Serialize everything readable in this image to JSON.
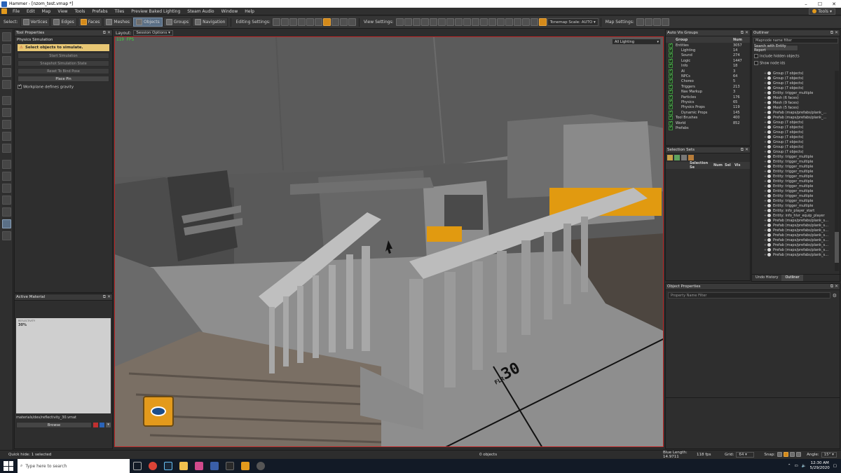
{
  "window": {
    "title": "Hammer - [nzom_test.vmap *]"
  },
  "menu": [
    "File",
    "Edit",
    "Map",
    "View",
    "Tools",
    "Prefabs",
    "Tiles",
    "Preview Baked Lighting",
    "Steam Audio",
    "Window",
    "Help"
  ],
  "menu_tools_right": "Tools",
  "toolbar": {
    "select_label": "Select:",
    "modes": [
      {
        "label": "Vertices"
      },
      {
        "label": "Edges"
      },
      {
        "label": "Faces"
      },
      {
        "label": "Meshes"
      },
      {
        "label": "Objects"
      },
      {
        "label": "Groups"
      },
      {
        "label": "Navigation"
      }
    ],
    "editing_label": "Editing Settings:",
    "view_label": "View Settings:",
    "tonemap": "Tonemap Scale: AUTO",
    "map_label": "Map Settings:"
  },
  "tool_properties": {
    "title": "Tool Properties",
    "section": "Physics Simulation",
    "hint": "Select objects to simulate.",
    "buttons": [
      "Start Simulation",
      "Snapshot Simulation State",
      "Reset To Bind Pose",
      "Place Pin"
    ],
    "checkbox": "Workplane defines gravity"
  },
  "layout": {
    "label": "Layout:",
    "value": "Session Options"
  },
  "viewport": {
    "fps": "119 FPS",
    "lighting": "All Lighting",
    "floor_number": "30",
    "floor_letters": "FLR"
  },
  "active_material": {
    "title": "Active Material",
    "preview_top": "REFLECTIVITY",
    "preview_sub": "30%",
    "path": "materials/dev/reflectivity_30.vmat",
    "browse": "Browse"
  },
  "auto_vis": {
    "title": "Auto Vis Groups",
    "cols": [
      "Group",
      "Num"
    ],
    "rows": [
      {
        "name": "Entities",
        "num": "3057",
        "indent": 0
      },
      {
        "name": "Lighting",
        "num": "14",
        "indent": 1
      },
      {
        "name": "Sound",
        "num": "274",
        "indent": 1
      },
      {
        "name": "Logic",
        "num": "1447",
        "indent": 1
      },
      {
        "name": "Info",
        "num": "18",
        "indent": 1
      },
      {
        "name": "AI",
        "num": "3",
        "indent": 1
      },
      {
        "name": "NPCs",
        "num": "64",
        "indent": 1
      },
      {
        "name": "Choreo",
        "num": "5",
        "indent": 1
      },
      {
        "name": "Triggers",
        "num": "213",
        "indent": 1
      },
      {
        "name": "Nav Markup",
        "num": "3",
        "indent": 1
      },
      {
        "name": "Particles",
        "num": "176",
        "indent": 1
      },
      {
        "name": "Physics",
        "num": "65",
        "indent": 1
      },
      {
        "name": "Physics Props",
        "num": "119",
        "indent": 1
      },
      {
        "name": "Dynamic Props",
        "num": "145",
        "indent": 1
      },
      {
        "name": "Tool Brushes",
        "num": "400",
        "indent": 0
      },
      {
        "name": "World",
        "num": "852",
        "indent": 0
      },
      {
        "name": "Prefabs",
        "num": "",
        "indent": 0
      }
    ]
  },
  "selection_sets": {
    "title": "Selection Sets",
    "cols": [
      "Selection Se",
      "Num",
      "Sel",
      "Vis"
    ]
  },
  "outliner": {
    "title": "Outliner",
    "filter_placeholder": "Mapnode name filter",
    "search_btn": "Search with Entity Report",
    "check_hidden": "Include hidden objects",
    "check_node": "Show node ids",
    "rows": [
      "Group (7 objects)",
      "Group (7 objects)",
      "Group (7 objects)",
      "Group (7 objects)",
      "Entity: trigger_multiple",
      "Mesh (6 faces)",
      "Mesh (9 faces)",
      "Mesh (5 faces)",
      "Prefab (maps/prefabs/plank_...",
      "Prefab (maps/prefabs/plank_...",
      "Group (7 objects)",
      "Group (7 objects)",
      "Group (7 objects)",
      "Group (7 objects)",
      "Group (7 objects)",
      "Group (7 objects)",
      "Group (7 objects)",
      "Entity: trigger_multiple",
      "Entity: trigger_multiple",
      "Entity: trigger_multiple",
      "Entity: trigger_multiple",
      "Entity: trigger_multiple",
      "Entity: trigger_multiple",
      "Entity: trigger_multiple",
      "Entity: trigger_multiple",
      "Entity: trigger_multiple",
      "Entity: trigger_multiple",
      "Entity: trigger_multiple",
      "Entity: info_player_start",
      "Entity: info_hlvr_equip_player",
      "Prefab (maps/prefabs/plank_s...",
      "Prefab (maps/prefabs/plank_s...",
      "Prefab (maps/prefabs/plank_s...",
      "Prefab (maps/prefabs/plank_s...",
      "Prefab (maps/prefabs/plank_s...",
      "Prefab (maps/prefabs/plank_s...",
      "Prefab (maps/prefabs/plank_s...",
      "Prefab (maps/prefabs/plank_s..."
    ],
    "tabs": [
      "Undo History",
      "Outliner"
    ]
  },
  "object_properties": {
    "title": "Object Properties",
    "filter_placeholder": "Property Name Filter"
  },
  "status": {
    "left": "Quick hide: 1 selected",
    "objects": "0 objects",
    "blue_length": "Blue Length: 14.9711",
    "fps": "118 fps",
    "grid_label": "Grid:",
    "grid_value": "64",
    "snap_label": "Snap:",
    "angle_label": "Angle:",
    "angle_value": "15°"
  },
  "taskbar": {
    "search_placeholder": "Type here to search",
    "time": "12:30 AM",
    "date": "5/29/2020"
  }
}
